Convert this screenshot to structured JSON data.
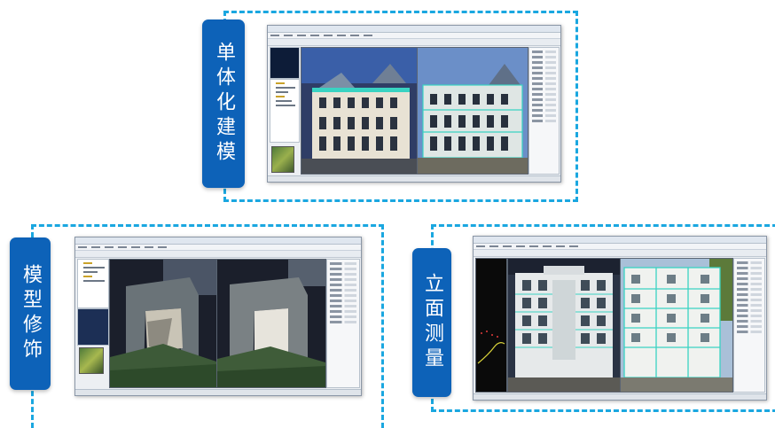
{
  "panels": {
    "top": {
      "label": "单体化建模"
    },
    "bottom_left": {
      "label": "模型修饰"
    },
    "bottom_right": {
      "label": "立面测量"
    }
  },
  "colors": {
    "frame_border": "#1aa7e0",
    "label_bg": "#0d62b8",
    "label_text": "#ffffff",
    "sky": "#3a5fa8",
    "building": "#e8e2d4",
    "highlight": "#39d3c2"
  },
  "icons": [
    "building-view-icon",
    "tree-panel-icon",
    "toolbar-icon"
  ]
}
